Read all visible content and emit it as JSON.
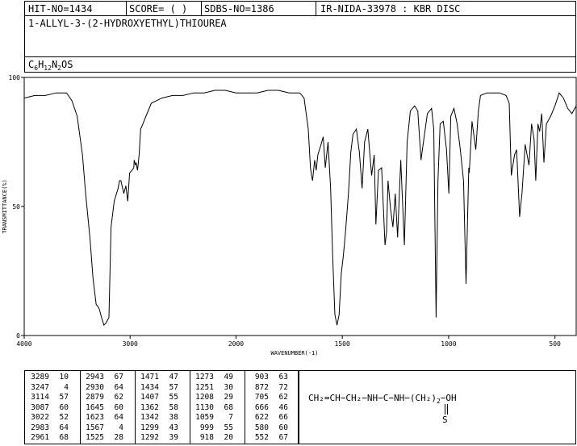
{
  "header": {
    "hit_no": "HIT-NO=1434",
    "score": "SCORE=  (   )",
    "sdbs_no": "SDBS-NO=1386",
    "ir_info": "IR-NIDA-33978 : KBR DISC",
    "compound_name": "1-ALLYL-3-(2-HYDROXYETHYL)THIOUREA",
    "formula": {
      "c": "C",
      "c_n": "6",
      "h": "H",
      "h_n": "12",
      "n": "N",
      "n_n": "2",
      "rest": "OS"
    }
  },
  "chart_data": {
    "type": "line",
    "xlabel": "WAVENUMBER(-1)",
    "ylabel": "TRANSMITTANCE(%)",
    "xlim": [
      4000,
      400
    ],
    "ylim": [
      0,
      100
    ],
    "x_ticks": [
      4000,
      3000,
      2000,
      1500,
      1000,
      500
    ],
    "y_ticks": [
      0,
      50,
      100
    ],
    "x_tick_labels": [
      "4000",
      "3000",
      "2000",
      "1500",
      "1000",
      "500"
    ],
    "y_tick_labels": [
      "0",
      "50",
      "100"
    ],
    "series": [
      {
        "x": [
          4000,
          3900,
          3800,
          3700,
          3600,
          3550,
          3500,
          3450,
          3420,
          3380,
          3350,
          3320,
          3300,
          3289,
          3270,
          3247,
          3225,
          3200,
          3180,
          3150,
          3114,
          3100,
          3087,
          3060,
          3040,
          3022,
          3005,
          2983,
          2965,
          2961,
          2950,
          2943,
          2935,
          2930,
          2915,
          2900,
          2879,
          2870,
          2850,
          2800,
          2700,
          2600,
          2500,
          2400,
          2300,
          2200,
          2100,
          2000,
          1900,
          1850,
          1800,
          1750,
          1700,
          1680,
          1660,
          1650,
          1645,
          1640,
          1630,
          1623,
          1615,
          1600,
          1590,
          1580,
          1567,
          1555,
          1545,
          1535,
          1525,
          1515,
          1505,
          1495,
          1485,
          1471,
          1460,
          1450,
          1434,
          1420,
          1407,
          1395,
          1380,
          1362,
          1350,
          1342,
          1330,
          1315,
          1299,
          1292,
          1285,
          1273,
          1262,
          1251,
          1240,
          1225,
          1208,
          1195,
          1180,
          1160,
          1145,
          1130,
          1120,
          1100,
          1080,
          1070,
          1059,
          1050,
          1040,
          1025,
          1010,
          999,
          990,
          975,
          960,
          945,
          930,
          918,
          905,
          903,
          890,
          872,
          860,
          850,
          820,
          790,
          760,
          730,
          715,
          705,
          690,
          680,
          666,
          655,
          640,
          622,
          610,
          598,
          590,
          580,
          572,
          562,
          552,
          540,
          520,
          500,
          480,
          460,
          440,
          420,
          400
        ],
        "y": [
          92,
          93,
          93,
          94,
          94,
          91,
          85,
          70,
          55,
          38,
          22,
          12,
          11,
          10,
          7,
          4,
          5,
          7,
          42,
          52,
          57,
          60,
          60,
          55,
          58,
          52,
          63,
          64,
          65,
          68,
          66,
          67,
          65,
          64,
          70,
          80,
          82,
          83,
          85,
          90,
          92,
          93,
          93,
          94,
          94,
          95,
          95,
          94,
          94,
          95,
          95,
          94,
          94,
          92,
          80,
          65,
          62,
          60,
          68,
          64,
          70,
          74,
          77,
          65,
          75,
          57,
          30,
          8,
          4,
          8,
          24,
          31,
          40,
          55,
          71,
          78,
          80,
          71,
          57,
          75,
          80,
          62,
          70,
          43,
          64,
          65,
          35,
          40,
          60,
          49,
          42,
          55,
          38,
          68,
          35,
          75,
          87,
          89,
          87,
          68,
          74,
          86,
          88,
          80,
          7,
          60,
          82,
          83,
          72,
          55,
          85,
          88,
          82,
          72,
          60,
          20,
          65,
          63,
          83,
          72,
          87,
          93,
          94,
          94,
          94,
          93,
          90,
          62,
          70,
          72,
          46,
          55,
          74,
          66,
          82,
          76,
          60,
          82,
          79,
          86,
          67,
          82,
          85,
          89,
          94,
          92,
          88,
          86,
          89
        ]
      }
    ]
  },
  "peak_table": {
    "columns": [
      [
        [
          "3289",
          "10"
        ],
        [
          "3247",
          "4"
        ],
        [
          "3114",
          "57"
        ],
        [
          "3087",
          "60"
        ],
        [
          "3022",
          "52"
        ],
        [
          "2983",
          "64"
        ],
        [
          "2961",
          "68"
        ]
      ],
      [
        [
          "2943",
          "67"
        ],
        [
          "2930",
          "64"
        ],
        [
          "2879",
          "62"
        ],
        [
          "1645",
          "60"
        ],
        [
          "1623",
          "64"
        ],
        [
          "1567",
          "4"
        ],
        [
          "1525",
          "28"
        ]
      ],
      [
        [
          "1471",
          "47"
        ],
        [
          "1434",
          "57"
        ],
        [
          "1407",
          "55"
        ],
        [
          "1362",
          "58"
        ],
        [
          "1342",
          "38"
        ],
        [
          "1299",
          "43"
        ],
        [
          "1292",
          "39"
        ]
      ],
      [
        [
          "1273",
          "49"
        ],
        [
          "1251",
          "30"
        ],
        [
          "1208",
          "29"
        ],
        [
          "1130",
          "68"
        ],
        [
          "1059",
          "7"
        ],
        [
          "999",
          "55"
        ],
        [
          "918",
          "20"
        ]
      ],
      [
        [
          "903",
          "63"
        ],
        [
          "872",
          "72"
        ],
        [
          "705",
          "62"
        ],
        [
          "666",
          "46"
        ],
        [
          "622",
          "66"
        ],
        [
          "580",
          "60"
        ],
        [
          "552",
          "67"
        ]
      ]
    ]
  },
  "structure": {
    "main": "CH₂=CH−CH₂−NH−C−NH−(CH₂)",
    "sub": "2",
    "tail": "−OH",
    "s_atom": "S"
  }
}
